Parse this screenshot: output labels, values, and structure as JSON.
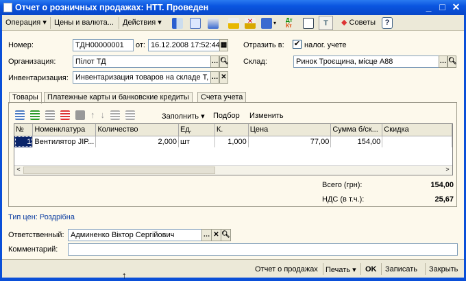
{
  "window": {
    "title": "Отчет о розничных продажах: НТТ. Проведен"
  },
  "toolbar": {
    "operation": "Операция",
    "prices": "Цены и валюта...",
    "actions": "Действия",
    "advice": "Советы",
    "help": "?"
  },
  "form": {
    "number_label": "Номер:",
    "number_value": "ТДН00000001",
    "date_label": "от:",
    "date_value": "16.12.2008 17:52:44",
    "reflect_label": "Отразить в:",
    "reflect_checkbox_label": "налог. учете",
    "reflect_checked": true,
    "org_label": "Организация:",
    "org_value": "Пілот ТД",
    "warehouse_label": "Склад:",
    "warehouse_value": "Ринок Троєщина, місце А88",
    "inventory_label": "Инвентаризация:",
    "inventory_value": "Инвентаризация товаров на складе Т,"
  },
  "tabs": [
    {
      "label": "Товары",
      "active": true
    },
    {
      "label": "Платежные карты и банковские кредиты"
    },
    {
      "label": "Счета учета"
    }
  ],
  "table_toolbar": {
    "fill": "Заполнить",
    "selection": "Подбор",
    "change": "Изменить"
  },
  "table": {
    "columns": [
      "№",
      "Номенклатура",
      "Количество",
      "Ед.",
      "К.",
      "Цена",
      "Сумма б/ск...",
      "Скидка"
    ],
    "rows": [
      [
        "1",
        "Вентилятор JIP...",
        "2,000",
        "шт",
        "1,000",
        "77,00",
        "154,00",
        ""
      ]
    ]
  },
  "totals": {
    "total_label": "Всего (грн):",
    "total_value": "154,00",
    "vat_label": "НДС (в т.ч.):",
    "vat_value": "25,67"
  },
  "price_type": "Тип цен: Роздрібна",
  "responsible_label": "Ответственный:",
  "responsible_value": "Админенко Віктор Сергійович",
  "comment_label": "Комментарий:",
  "comment_value": "",
  "bottom": {
    "report": "Отчет о продажах",
    "print": "Печать",
    "ok": "OK",
    "save": "Записать",
    "close": "Закрыть"
  }
}
